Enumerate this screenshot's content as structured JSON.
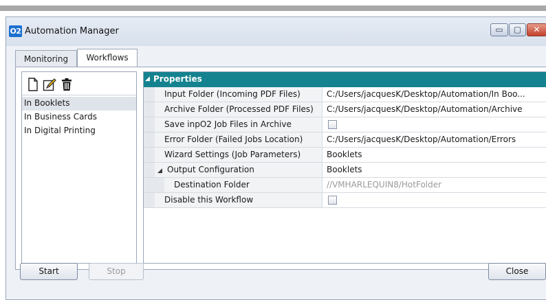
{
  "window": {
    "logo_text": "O2",
    "title": "Automation Manager",
    "controls": {
      "minimize": "▭",
      "maximize": "▢",
      "close": "✕"
    }
  },
  "tabs": [
    {
      "label": "Monitoring",
      "active": false
    },
    {
      "label": "Workflows",
      "active": true
    }
  ],
  "sidebar": {
    "toolbar": [
      "new-document-icon",
      "edit-icon",
      "delete-icon"
    ],
    "workflows": [
      {
        "label": "In Booklets",
        "selected": true
      },
      {
        "label": "In Business Cards",
        "selected": false
      },
      {
        "label": "In Digital Printing",
        "selected": false
      }
    ]
  },
  "properties": {
    "header": "Properties",
    "rows": [
      {
        "name": "Input Folder (Incoming PDF Files)",
        "value": "C:/Users/jacquesK/Desktop/Automation/In Boo..."
      },
      {
        "name": "Archive Folder (Processed PDF Files)",
        "value": "C:/Users/jacquesK/Desktop/Automation/Archive"
      },
      {
        "name": "Save inpO2 Job Files in Archive",
        "checked": false
      },
      {
        "name": "Error Folder (Failed Jobs Location)",
        "value": "C:/Users/jacquesK/Desktop/Automation/Errors"
      },
      {
        "name": "Wizard Settings (Job Parameters)",
        "value": "Booklets"
      },
      {
        "name": "Output Configuration",
        "value": "Booklets",
        "expander": "◢"
      },
      {
        "name": "Destination Folder",
        "value": "//VMHARLEQUIN8/HotFolder"
      },
      {
        "name": "Disable this Workflow",
        "checked": false
      }
    ]
  },
  "buttons": {
    "start": "Start",
    "stop": "Stop",
    "close": "Close"
  },
  "colors": {
    "header": "#14838f",
    "app_logo": "#1d6fd0",
    "close_control": "#c2412c"
  }
}
